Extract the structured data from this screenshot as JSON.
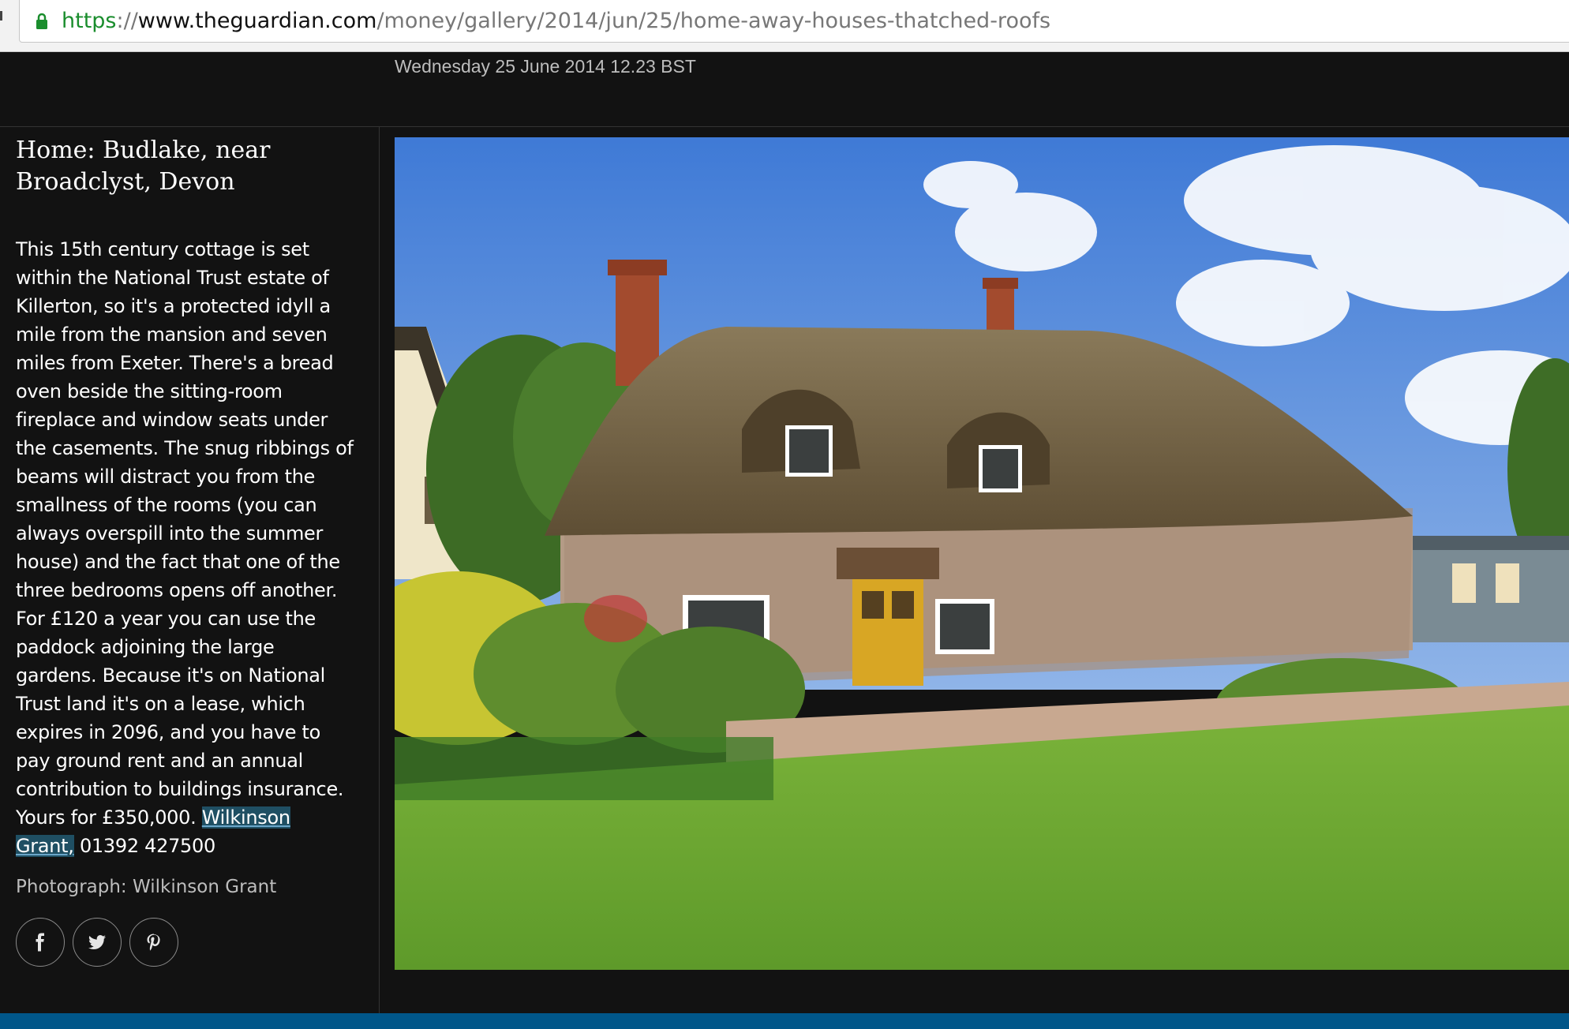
{
  "browser": {
    "url_scheme": "https",
    "url_sep": "://",
    "url_host": "www.theguardian.com",
    "url_path": "/money/gallery/2014/jun/25/home-away-houses-thatched-roofs"
  },
  "header": {
    "dateline": "Wednesday 25 June 2014 12.23 BST"
  },
  "caption": {
    "title": "Home: Budlake, near Broadclyst, Devon",
    "body": "This 15th century cottage is set within the National Trust estate of Killerton, so it's a protected idyll a mile from the mansion and seven miles from Exeter. There's a bread oven beside the sitting-room fireplace and window seats under the casements. The snug ribbings of beams will distract you from the smallness of the rooms (you can always overspill into the summer house) and the fact that one of the three bedrooms opens off another. For £120 a year you can use the paddock adjoining the large gardens. Because it's on National Trust land it's on a lease, which expires in 2096, and you have to pay ground rent and an annual contribution to buildings insurance. Yours for £350,000. ",
    "agent_link": "Wilkinson Grant,",
    "phone": " 01392 427500",
    "credit": "Photograph: Wilkinson Grant"
  },
  "share": {
    "facebook_icon": "facebook-icon",
    "twitter_icon": "twitter-icon",
    "pinterest_icon": "pinterest-icon"
  },
  "colors": {
    "background": "#121212",
    "accent_bar": "#005689",
    "link_highlight": "#1f4f63"
  }
}
